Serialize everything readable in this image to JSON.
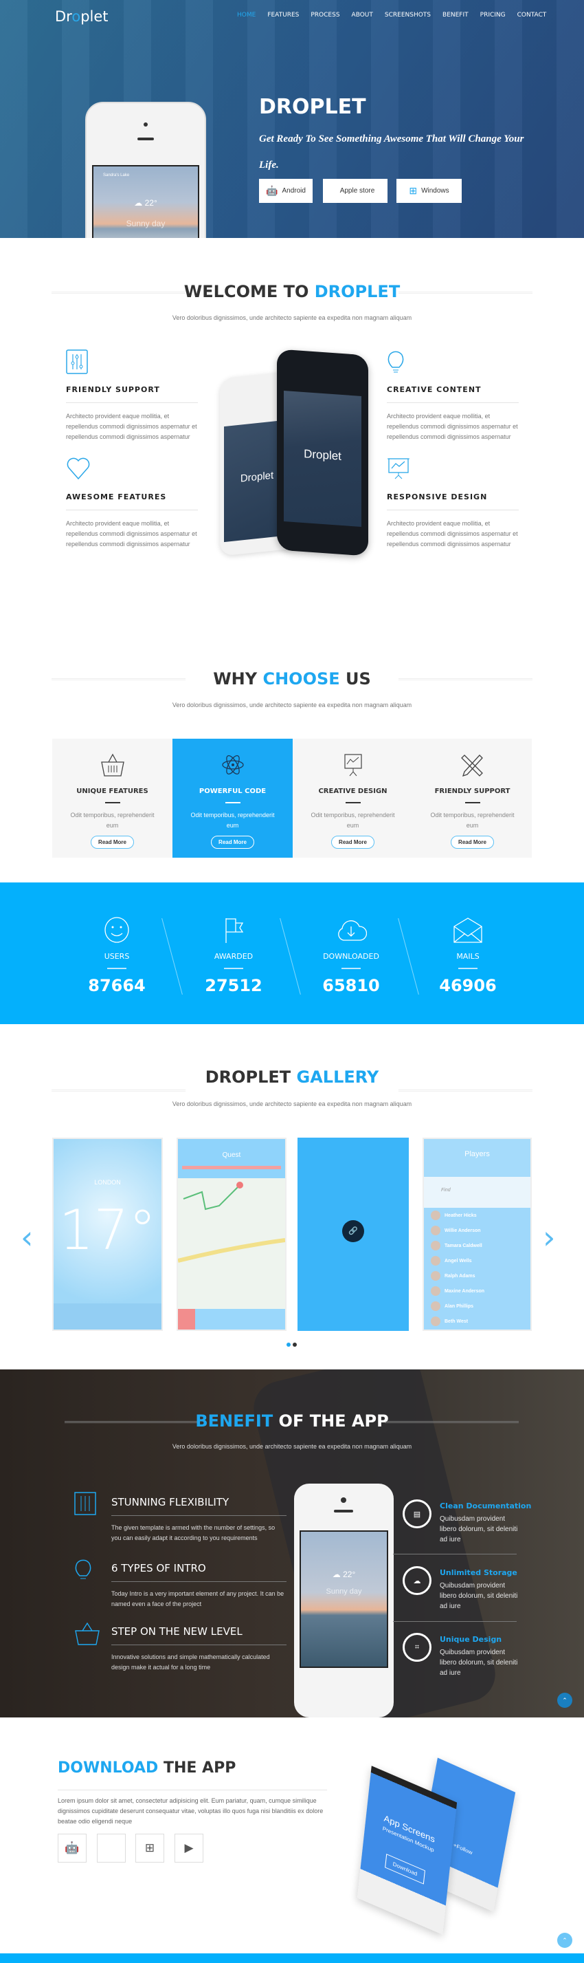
{
  "header": {
    "logo_pre": "Dr",
    "logo_o": "o",
    "logo_post": "plet",
    "nav": [
      "HOME",
      "FEATURES",
      "PROCESS",
      "ABOUT",
      "SCREENSHOTS",
      "BENEFIT",
      "PRICING",
      "CONTACT"
    ],
    "active": "HOME"
  },
  "hero": {
    "title": "DROPLET",
    "tagline": "Get Ready To See Something Awesome That Will Change Your Life.",
    "phone_location": "Sandra's Lake",
    "phone_temp": "22°",
    "phone_weather": "Sunny day",
    "buttons": [
      {
        "label": "Android",
        "icon": "android-icon"
      },
      {
        "label": "Apple store",
        "icon": "apple-icon"
      },
      {
        "label": "Windows",
        "icon": "windows-icon"
      }
    ]
  },
  "welcome": {
    "title_a": "WELCOME TO ",
    "title_b": "DROPLET",
    "subtitle": "Vero doloribus dignissimos, unde architecto sapiente ea expedita non magnam aliquam",
    "phone_brand": "Droplet",
    "features": [
      {
        "title": "FRIENDLY SUPPORT",
        "icon": "sliders-icon",
        "text": "Architecto provident eaque mollitia, et repellendus commodi dignissimos aspernatur et repellendus commodi dignissimos aspernatur"
      },
      {
        "title": "AWESOME FEATURES",
        "icon": "heart-icon",
        "text": "Architecto provident eaque mollitia, et repellendus commodi dignissimos aspernatur et repellendus commodi dignissimos aspernatur"
      },
      {
        "title": "CREATIVE CONTENT",
        "icon": "lightbulb-icon",
        "text": "Architecto provident eaque mollitia, et repellendus commodi dignissimos aspernatur et repellendus commodi dignissimos aspernatur"
      },
      {
        "title": "RESPONSIVE DESIGN",
        "icon": "presentation-chart-icon",
        "text": "Architecto provident eaque mollitia, et repellendus commodi dignissimos aspernatur et repellendus commodi dignissimos aspernatur"
      }
    ]
  },
  "why": {
    "title_a": "WHY ",
    "title_b": "CHOOSE",
    "title_c": " US",
    "subtitle": "Vero doloribus dignissimos, unde architecto sapiente ea expedita non magnam aliquam",
    "cards": [
      {
        "title": "UNIQUE FEATURES",
        "icon": "basket-icon",
        "text": "Odit temporibus, reprehenderit eum",
        "button": "Read More"
      },
      {
        "title": "POWERFUL CODE",
        "icon": "atom-icon",
        "text": "Odit temporibus, reprehenderit eum",
        "button": "Read More",
        "highlighted": true
      },
      {
        "title": "CREATIVE DESIGN",
        "icon": "presentation-chart-icon",
        "text": "Odit temporibus, reprehenderit eum",
        "button": "Read More"
      },
      {
        "title": "FRIENDLY SUPPORT",
        "icon": "pencil-ruler-icon",
        "text": "Odit temporibus, reprehenderit eum",
        "button": "Read More"
      }
    ]
  },
  "stats": [
    {
      "label": "USERS",
      "value": "87664",
      "icon": "smiley-icon"
    },
    {
      "label": "AWARDED",
      "value": "27512",
      "icon": "flag-icon"
    },
    {
      "label": "DOWNLOADED",
      "value": "65810",
      "icon": "cloud-download-icon"
    },
    {
      "label": "MAILS",
      "value": "46906",
      "icon": "envelope-icon"
    }
  ],
  "gallery": {
    "title_a": "DROPLET ",
    "title_b": "GALLERY",
    "subtitle": "Vero doloribus dignissimos, unde architecto sapiente ea expedita non magnam aliquam",
    "weather_city": "LONDON",
    "weather_temp": "17°",
    "quest_title": "Quest",
    "players_title": "Players",
    "players_search": "Find",
    "players": [
      "Heather Hicks",
      "Willie Anderson",
      "Tamara Caldwell",
      "Angel Wells",
      "Ralph Adams",
      "Maxine Anderson",
      "Alan Phillips",
      "Beth West"
    ],
    "page": 1,
    "pages": 2
  },
  "benefit": {
    "title_a": "BENEFIT",
    "title_b": " OF THE APP",
    "subtitle": "Vero doloribus dignissimos, unde architecto sapiente ea expedita non magnam aliquam",
    "left": [
      {
        "title": "STUNNING FLEXIBILITY",
        "icon": "sliders-icon",
        "text": "The given template is armed with the number of settings, so you can easily adapt it according to you requirements"
      },
      {
        "title": "6 TYPES OF INTRO",
        "icon": "lightbulb-icon",
        "text": "Today Intro is a very important element of any project. It can be named even a face of the project"
      },
      {
        "title": "STEP ON THE NEW LEVEL",
        "icon": "basket-icon",
        "text": "Innovative solutions and simple mathematically calculated design make it actual for a long time"
      }
    ],
    "right": [
      {
        "title": "Clean Documentation",
        "icon": "document-icon",
        "text": "Quibusdam provident libero dolorum, sit deleniti ad iure"
      },
      {
        "title": "Unlimited Storage",
        "icon": "cloud-icon",
        "text": "Quibusdam provident libero dolorum, sit deleniti ad iure"
      },
      {
        "title": "Unique Design",
        "icon": "focus-icon",
        "text": "Quibusdam provident libero dolorum, sit deleniti ad iure"
      }
    ]
  },
  "download": {
    "title_a": "DOWNLOAD",
    "title_b": " THE APP",
    "text": "Lorem ipsum dolor sit amet, consectetur adipisicing elit. Eum pariatur, quam, cumque similique dignissimos cupiditate deserunt consequatur vitae, voluptas illo quos fuga nisi blanditiis ex dolore beatae odio eligendi neque",
    "buttons": [
      "android-icon",
      "apple-icon",
      "windows-icon",
      "play-icon"
    ],
    "mock_title": "App Screens",
    "mock_sub": "Presentation Mockup",
    "mock_btn": "Download",
    "mock_follow": "+Follow"
  },
  "colors": {
    "accent": "#1ea7f0",
    "stats_bg": "#04b0fc",
    "hero_bg": "#2a5a8c"
  }
}
